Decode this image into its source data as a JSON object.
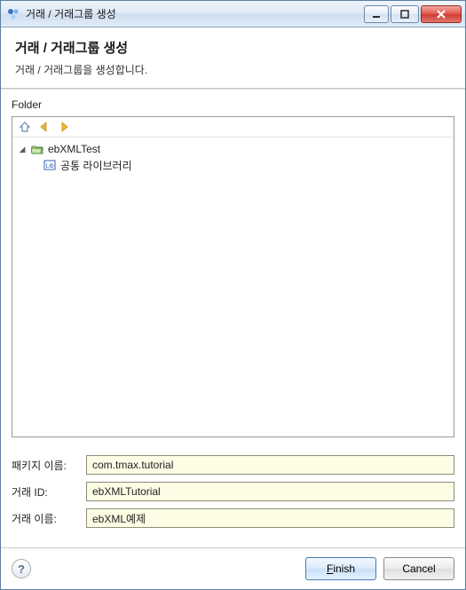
{
  "window": {
    "title": "거래 / 거래그룹 생성"
  },
  "header": {
    "title": "거래 / 거래그룹 생성",
    "subtitle": "거래 / 거래그룹을 생성합니다."
  },
  "folder": {
    "label": "Folder",
    "toolbar": {
      "home_icon": "home-icon",
      "back_icon": "arrow-left-icon",
      "forward_icon": "arrow-right-icon"
    },
    "tree": {
      "root": {
        "label": "ebXMLTest",
        "icon": "folder-open-icon",
        "expanded": true,
        "children": [
          {
            "label": "공통 라이브러리",
            "icon": "lib-icon"
          }
        ]
      }
    }
  },
  "form": {
    "package_label": "패키지 이름:",
    "package_value": "com.tmax.tutorial",
    "txid_label": "거래 ID:",
    "txid_value": "ebXMLTutorial",
    "txname_label": "거래 이름:",
    "txname_value": "ebXML예제"
  },
  "footer": {
    "help_icon": "help-icon",
    "finish_label": "Finish",
    "cancel_label": "Cancel"
  }
}
